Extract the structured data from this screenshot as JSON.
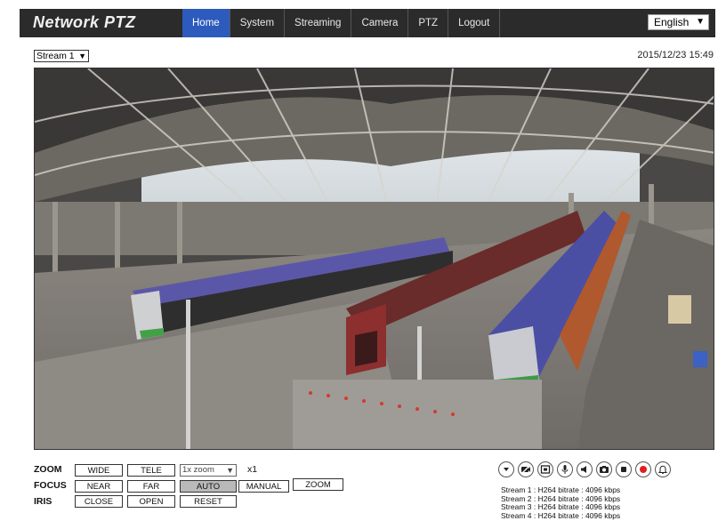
{
  "header": {
    "brand": "Network PTZ",
    "nav": [
      "Home",
      "System",
      "Streaming",
      "Camera",
      "PTZ",
      "Logout"
    ],
    "active_nav": "Home",
    "language": "English"
  },
  "stream_selector": {
    "value": "Stream 1"
  },
  "datetime": "2015/12/23 15:49",
  "controls": {
    "zoom": {
      "label": "ZOOM",
      "wide": "WIDE",
      "tele": "TELE",
      "zoom_select": "1x zoom",
      "level": "x1"
    },
    "focus": {
      "label": "FOCUS",
      "near": "NEAR",
      "far": "FAR",
      "auto": "AUTO",
      "manual": "MANUAL",
      "zoom": "ZOOM"
    },
    "iris": {
      "label": "IRIS",
      "close": "CLOSE",
      "open": "OPEN",
      "reset": "RESET"
    }
  },
  "icons": [
    "dropdown-icon",
    "privacy-icon",
    "fullscreen-icon",
    "microphone-icon",
    "speaker-icon",
    "snapshot-icon",
    "stop-icon",
    "record-icon",
    "alarm-icon"
  ],
  "stream_status": [
    "Stream 1 : H264 bitrate : 4096 kbps",
    "Stream 2 : H264 bitrate : 4096 kbps",
    "Stream 3 : H264 bitrate : 4096 kbps",
    "Stream 4 : H264 bitrate : 4096 kbps"
  ],
  "colors": {
    "nav_bg": "#2b2b2b",
    "nav_active": "#2d5bbd",
    "record": "#e02020",
    "auto_active": "#b9b9b9"
  }
}
